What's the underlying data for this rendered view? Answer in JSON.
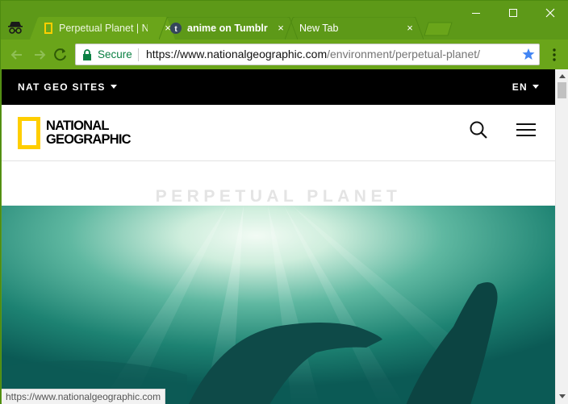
{
  "browser": {
    "tabs": [
      {
        "label": "Perpetual Planet | N",
        "favicon": "natgeo-yellow-frame",
        "active": true
      },
      {
        "label": "anime on Tumblr",
        "favicon": "tumblr-icon",
        "active": false
      },
      {
        "label": "New Tab",
        "favicon": "",
        "active": false
      }
    ],
    "close_glyph": "×",
    "security_label": "Secure",
    "url_scheme_host": "https://www.nationalgeographic.com",
    "url_path": "/environment/perpetual-planet/",
    "status_url": "https://www.nationalgeographic.com"
  },
  "page": {
    "top_nav": {
      "sites_label": "NAT GEO SITES",
      "language": "EN"
    },
    "logo": {
      "line1": "NATIONAL",
      "line2": "GEOGRAPHIC"
    },
    "section_title": "PERPETUAL PLANET"
  },
  "colors": {
    "chrome_green": "#6aa51a",
    "natgeo_yellow": "#ffce00",
    "secure_green": "#0b8043",
    "star_blue": "#4285f4"
  }
}
